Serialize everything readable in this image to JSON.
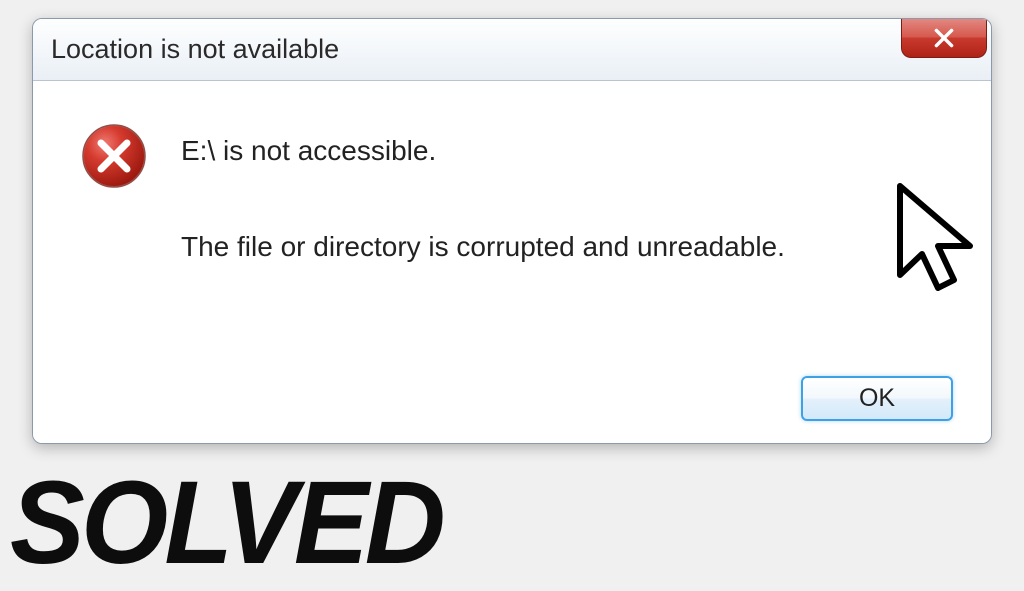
{
  "dialog": {
    "title": "Location is not available",
    "error_main": "E:\\ is not accessible.",
    "error_detail": "The file or directory is corrupted and unreadable.",
    "ok_label": "OK"
  },
  "overlay": {
    "text": "SOLVED"
  },
  "colors": {
    "close_red": "#c83a2e",
    "accent_blue": "#3ea1e6"
  }
}
